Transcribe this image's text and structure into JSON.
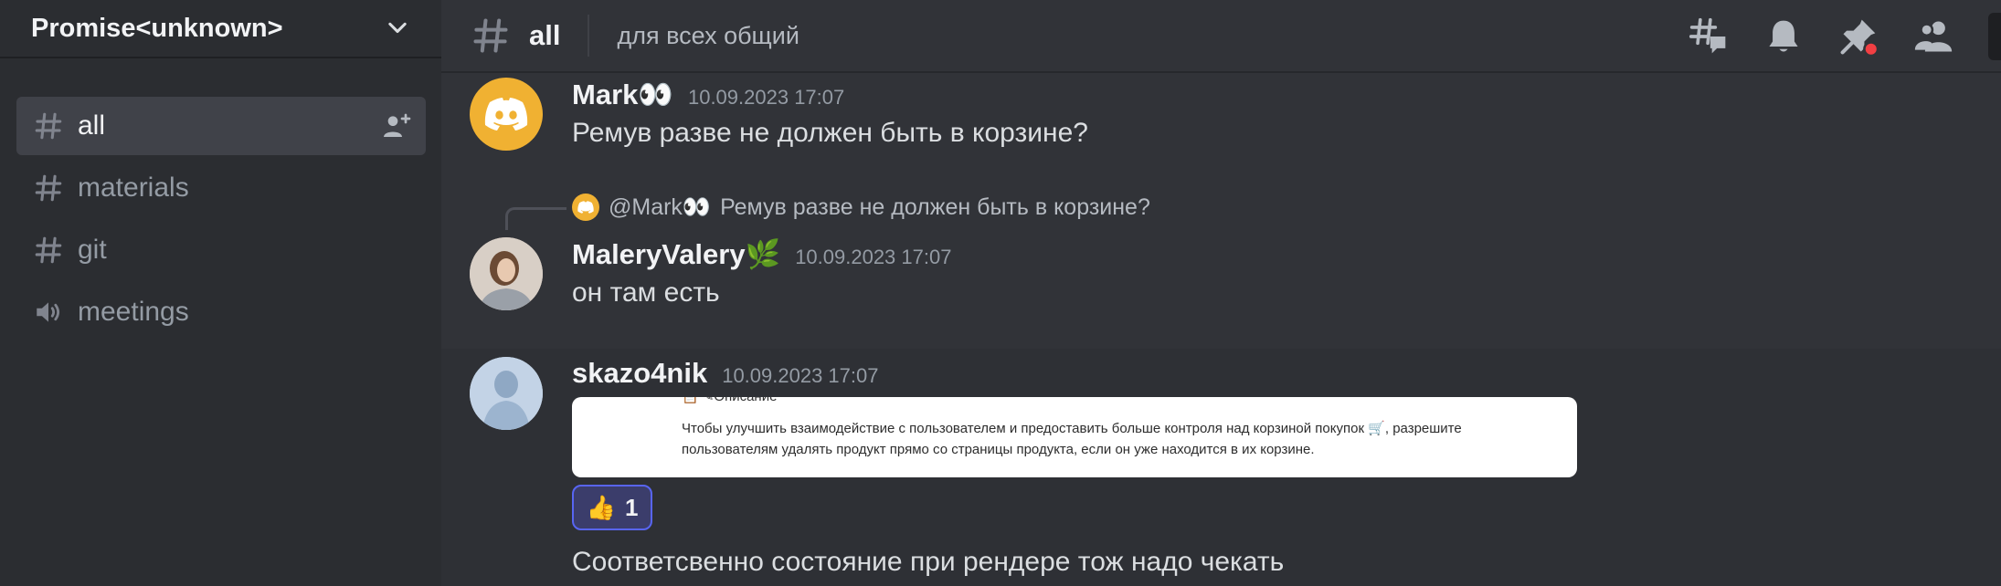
{
  "server": {
    "name": "Promise<unknown>"
  },
  "channels": [
    {
      "label": "all",
      "type": "text"
    },
    {
      "label": "materials",
      "type": "text"
    },
    {
      "label": "git",
      "type": "text"
    },
    {
      "label": "meetings",
      "type": "voice"
    }
  ],
  "header": {
    "channel_name": "all",
    "topic": "для всех общий",
    "icons": [
      "threads-icon",
      "bell-icon",
      "pin-icon",
      "members-icon"
    ]
  },
  "messages": [
    {
      "author": "Mark👀",
      "timestamp": "10.09.2023 17:07",
      "text": "Ремув разве не должен быть в корзине?"
    },
    {
      "reply_to": {
        "author": "@Mark👀",
        "text": "Ремув разве не должен быть в корзине?"
      },
      "author": "MaleryValery🌿",
      "timestamp": "10.09.2023 17:07",
      "text": "он там есть"
    },
    {
      "author": "skazo4nik",
      "timestamp": "10.09.2023 17:07",
      "embed": {
        "heading_cut": "📋 ✎Описание",
        "line1": "Чтобы улучшить взаимодействие с пользователем и предоставить больше контроля над корзиной покупок 🛒, разрешите",
        "line2": "пользователям удалять продукт прямо со страницы продукта, если он уже находится в их корзине."
      },
      "reaction": {
        "emoji": "👍",
        "count": "1"
      }
    },
    {
      "text": "Соответсвенно состояние при рендере тож надо чекать"
    }
  ],
  "colors": {
    "accent": "#5865f2",
    "orange_avatar": "#f0b132",
    "background": "#313338",
    "sidebar": "#2b2d31"
  }
}
